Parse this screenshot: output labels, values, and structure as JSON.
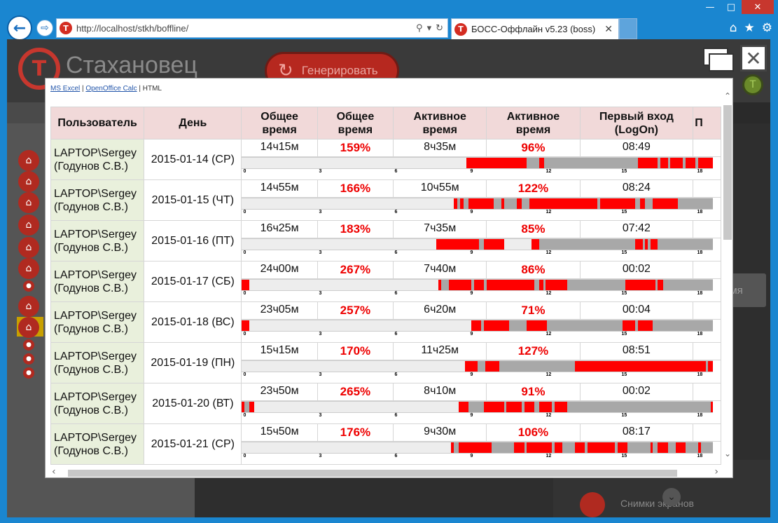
{
  "browser": {
    "url": "http://localhost/stkh/boffline/",
    "tab_title": "БОСС-Оффлайн v5.23 (boss)",
    "favicon_letter": "T"
  },
  "app": {
    "logo_text": "Стахановец",
    "generate_button": "Генерировать",
    "side_button_partial": "емя",
    "snapshots_label": "Снимки экранов"
  },
  "report": {
    "export_links": [
      "MS Excel",
      "OpenOffice Calc"
    ],
    "export_current": "HTML",
    "headers": {
      "user": "Пользователь",
      "day": "День",
      "total_time": "Общее время",
      "total_time_pct": "Общее время",
      "active_time": "Активное время",
      "active_time_pct": "Активное время",
      "first_logon": "Первый вход (LogOn)",
      "next_partial": "П"
    },
    "tick_labels": [
      "0",
      "3",
      "6",
      "9",
      "12",
      "15",
      "18"
    ],
    "rows": [
      {
        "user": "LAPTOP\\Sergey (Годунов С.В.)",
        "day": "2015-01-14 (СР)",
        "total": "14ч15м",
        "total_pct": "159%",
        "active": "8ч35м",
        "active_pct": "96%",
        "logon": "08:49",
        "segments": [
          [
            "r",
            8.9,
            11.0
          ],
          [
            "r",
            11.0,
            11.3
          ],
          [
            "g",
            11.3,
            11.8
          ],
          [
            "r",
            11.8,
            12.0
          ],
          [
            "g",
            12.0,
            15.7
          ],
          [
            "r",
            15.7,
            16.5
          ],
          [
            "g",
            16.5,
            16.6
          ],
          [
            "r",
            16.6,
            16.9
          ],
          [
            "g",
            16.9,
            17.0
          ],
          [
            "r",
            17.0,
            17.5
          ],
          [
            "g",
            17.5,
            17.6
          ],
          [
            "r",
            17.6,
            18.0
          ],
          [
            "g",
            18.0,
            18.1
          ],
          [
            "r",
            18.1,
            18.7
          ],
          [
            "g",
            18.7,
            18.9
          ],
          [
            "r",
            18.9,
            19.3
          ]
        ]
      },
      {
        "user": "LAPTOP\\Sergey (Годунов С.В.)",
        "day": "2015-01-15 (ЧТ)",
        "total": "14ч55м",
        "total_pct": "166%",
        "active": "10ч55м",
        "active_pct": "122%",
        "logon": "08:24",
        "segments": [
          [
            "r",
            8.4,
            8.55
          ],
          [
            "g",
            8.55,
            8.65
          ],
          [
            "r",
            8.65,
            8.8
          ],
          [
            "g",
            8.8,
            9.0
          ],
          [
            "r",
            9.0,
            10.0
          ],
          [
            "g",
            10.0,
            10.3
          ],
          [
            "r",
            10.3,
            10.4
          ],
          [
            "g",
            10.4,
            10.9
          ],
          [
            "r",
            10.9,
            11.1
          ],
          [
            "g",
            11.1,
            11.4
          ],
          [
            "r",
            11.4,
            14.1
          ],
          [
            "g",
            14.1,
            14.2
          ],
          [
            "r",
            14.2,
            15.6
          ],
          [
            "g",
            15.6,
            15.8
          ],
          [
            "r",
            15.8,
            16.0
          ],
          [
            "g",
            16.0,
            16.3
          ],
          [
            "r",
            16.3,
            17.3
          ],
          [
            "g",
            17.3,
            19.1
          ],
          [
            "r",
            19.1,
            19.3
          ]
        ]
      },
      {
        "user": "LAPTOP\\Sergey (Годунов С.В.)",
        "day": "2015-01-16 (ПТ)",
        "total": "16ч25м",
        "total_pct": "183%",
        "active": "7ч35м",
        "active_pct": "85%",
        "logon": "07:42",
        "segments": [
          [
            "r",
            7.7,
            9.4
          ],
          [
            "g",
            9.4,
            9.6
          ],
          [
            "r",
            9.6,
            10.4
          ],
          [
            "r",
            11.5,
            11.8
          ],
          [
            "g",
            11.8,
            15.6
          ],
          [
            "r",
            15.6,
            15.9
          ],
          [
            "g",
            15.9,
            16.0
          ],
          [
            "r",
            16.0,
            16.1
          ],
          [
            "g",
            16.1,
            16.2
          ],
          [
            "r",
            16.2,
            16.5
          ],
          [
            "g",
            16.5,
            19.2
          ],
          [
            "r",
            19.2,
            19.3
          ]
        ]
      },
      {
        "user": "LAPTOP\\Sergey (Годунов С.В.)",
        "day": "2015-01-17 (СБ)",
        "total": "24ч00м",
        "total_pct": "267%",
        "active": "7ч40м",
        "active_pct": "86%",
        "logon": "00:02",
        "segments": [
          [
            "r",
            0.0,
            0.3
          ],
          [
            "r",
            7.8,
            7.9
          ],
          [
            "g",
            7.9,
            8.2
          ],
          [
            "r",
            8.2,
            9.1
          ],
          [
            "g",
            9.1,
            9.2
          ],
          [
            "r",
            9.2,
            9.6
          ],
          [
            "g",
            9.6,
            9.7
          ],
          [
            "r",
            9.7,
            11.6
          ],
          [
            "g",
            11.6,
            11.8
          ],
          [
            "r",
            11.8,
            11.95
          ],
          [
            "g",
            11.95,
            12.05
          ],
          [
            "r",
            12.05,
            12.9
          ],
          [
            "g",
            12.9,
            15.2
          ],
          [
            "r",
            15.2,
            16.4
          ],
          [
            "g",
            16.4,
            16.5
          ],
          [
            "r",
            16.5,
            16.7
          ],
          [
            "g",
            16.7,
            19.3
          ]
        ]
      },
      {
        "user": "LAPTOP\\Sergey (Годунов С.В.)",
        "day": "2015-01-18 (ВС)",
        "total": "23ч05м",
        "total_pct": "257%",
        "active": "6ч20м",
        "active_pct": "71%",
        "logon": "00:04",
        "segments": [
          [
            "r",
            0.0,
            0.3
          ],
          [
            "r",
            9.1,
            9.5
          ],
          [
            "g",
            9.5,
            9.6
          ],
          [
            "r",
            9.6,
            10.6
          ],
          [
            "g",
            10.6,
            11.3
          ],
          [
            "r",
            11.3,
            12.1
          ],
          [
            "g",
            12.1,
            15.1
          ],
          [
            "r",
            15.1,
            15.6
          ],
          [
            "g",
            15.6,
            15.7
          ],
          [
            "r",
            15.7,
            16.3
          ],
          [
            "g",
            16.3,
            18.9
          ],
          [
            "r",
            18.9,
            19.1
          ],
          [
            "g",
            19.1,
            19.3
          ]
        ]
      },
      {
        "user": "LAPTOP\\Sergey (Годунов С.В.)",
        "day": "2015-01-19 (ПН)",
        "total": "15ч15м",
        "total_pct": "170%",
        "active": "11ч25м",
        "active_pct": "127%",
        "logon": "08:51",
        "segments": [
          [
            "r",
            8.85,
            9.35
          ],
          [
            "g",
            9.35,
            9.65
          ],
          [
            "r",
            9.65,
            10.2
          ],
          [
            "g",
            10.2,
            13.2
          ],
          [
            "r",
            13.2,
            18.4
          ],
          [
            "g",
            18.4,
            18.5
          ],
          [
            "r",
            18.5,
            19.3
          ]
        ]
      },
      {
        "user": "LAPTOP\\Sergey (Годунов С.В.)",
        "day": "2015-01-20 (ВТ)",
        "total": "23ч50м",
        "total_pct": "265%",
        "active": "8ч10м",
        "active_pct": "91%",
        "logon": "00:02",
        "segments": [
          [
            "r",
            0.0,
            0.1
          ],
          [
            "g",
            0.1,
            0.3
          ],
          [
            "r",
            0.3,
            0.5
          ],
          [
            "r",
            8.6,
            9.0
          ],
          [
            "g",
            9.0,
            9.6
          ],
          [
            "r",
            9.6,
            10.4
          ],
          [
            "g",
            10.4,
            10.5
          ],
          [
            "r",
            10.5,
            11.1
          ],
          [
            "g",
            11.1,
            11.2
          ],
          [
            "r",
            11.2,
            11.6
          ],
          [
            "g",
            11.6,
            11.8
          ],
          [
            "r",
            11.8,
            12.3
          ],
          [
            "g",
            12.3,
            12.4
          ],
          [
            "r",
            12.4,
            12.9
          ],
          [
            "g",
            12.9,
            18.6
          ],
          [
            "r",
            18.6,
            19.3
          ]
        ]
      },
      {
        "user": "LAPTOP\\Sergey (Годунов С.В.)",
        "day": "2015-01-21 (СР)",
        "total": "15ч50м",
        "total_pct": "176%",
        "active": "9ч30м",
        "active_pct": "106%",
        "logon": "08:17",
        "segments": [
          [
            "r",
            8.3,
            8.4
          ],
          [
            "g",
            8.4,
            8.6
          ],
          [
            "r",
            8.6,
            9.9
          ],
          [
            "g",
            9.9,
            10.8
          ],
          [
            "r",
            10.8,
            11.2
          ],
          [
            "g",
            11.2,
            11.3
          ],
          [
            "r",
            11.3,
            12.3
          ],
          [
            "g",
            12.3,
            12.4
          ],
          [
            "r",
            12.4,
            12.7
          ],
          [
            "g",
            12.7,
            13.2
          ],
          [
            "r",
            13.2,
            13.6
          ],
          [
            "g",
            13.6,
            13.7
          ],
          [
            "r",
            13.7,
            14.8
          ],
          [
            "g",
            14.8,
            14.9
          ],
          [
            "r",
            14.9,
            15.3
          ],
          [
            "g",
            15.3,
            16.2
          ],
          [
            "r",
            16.2,
            16.3
          ],
          [
            "g",
            16.3,
            16.5
          ],
          [
            "r",
            16.5,
            16.9
          ],
          [
            "g",
            16.9,
            17.2
          ],
          [
            "r",
            17.2,
            17.6
          ],
          [
            "g",
            17.6,
            18.1
          ],
          [
            "r",
            18.1,
            18.2
          ],
          [
            "g",
            18.2,
            19.3
          ]
        ]
      }
    ]
  }
}
